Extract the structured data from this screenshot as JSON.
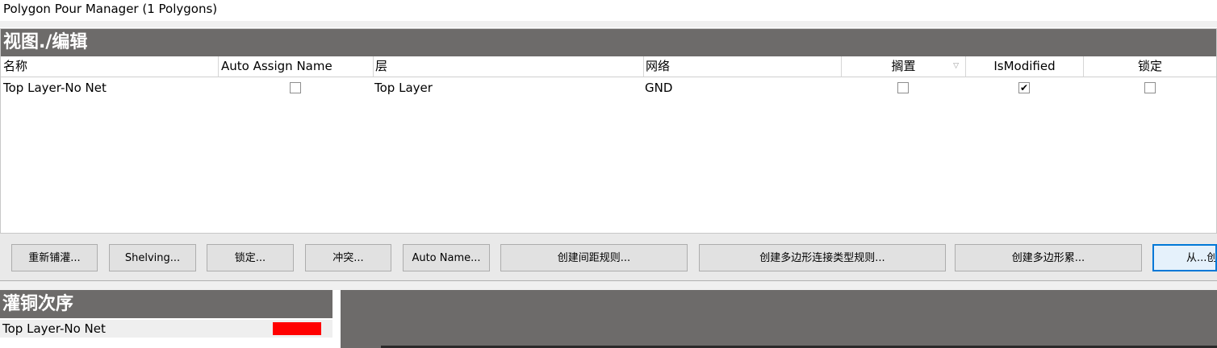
{
  "window": {
    "title": "Polygon Pour Manager (1 Polygons)"
  },
  "view_edit": {
    "header": "视图./编辑",
    "columns": {
      "name": "名称",
      "auto_assign_name": "Auto Assign Name",
      "layer": "层",
      "net": "网络",
      "shelved": "搁置",
      "is_modified": "IsModified",
      "locked": "锁定"
    },
    "rows": [
      {
        "name": "Top Layer-No Net",
        "auto_assign_name": false,
        "layer": "Top Layer",
        "net": "GND",
        "shelved": false,
        "is_modified": true,
        "is_modified_mark": "✔",
        "locked": false
      }
    ]
  },
  "toolbar": {
    "repour": "重新铺灌...",
    "shelving": "Shelving...",
    "lock": "锁定...",
    "violations": "冲突...",
    "auto_name": "Auto Name...",
    "create_clearance_rule": "创建间距规则...",
    "create_connect_style_rule": "创建多边形连接类型规则...",
    "create_polygon_class": "创建多边形累...",
    "from": "从...创"
  },
  "pour_order": {
    "header": "灌铜次序",
    "items": [
      {
        "name": "Top Layer-No Net",
        "color": "#ff0000"
      }
    ]
  }
}
